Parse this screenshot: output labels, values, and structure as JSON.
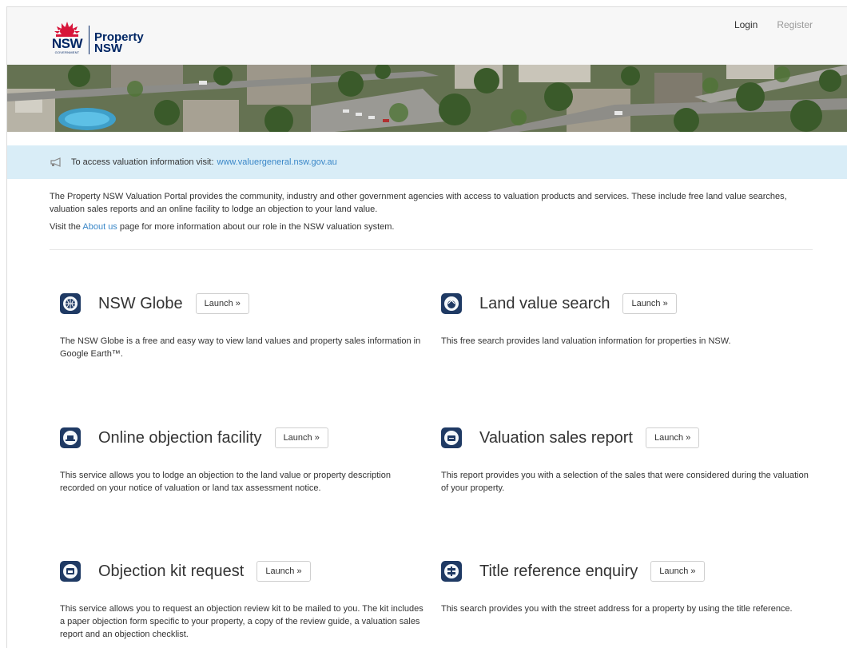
{
  "header": {
    "logo_nsw": "NSW",
    "logo_gov": "GOVERNMENT",
    "logo_property_line1": "Property",
    "logo_property_line2": "NSW",
    "login_label": "Login",
    "register_label": "Register"
  },
  "notice": {
    "text": "To access valuation information visit:",
    "link": "www.valuergeneral.nsw.gov.au"
  },
  "intro": {
    "paragraph": "The Property NSW Valuation Portal provides the community, industry and other government agencies with access to valuation products and services. These include free land value searches, valuation sales reports and an online facility to lodge an objection to your land value.",
    "about_prefix": "Visit the",
    "about_link": "About us",
    "about_suffix": "page for more information about our role in the NSW valuation system."
  },
  "services": [
    {
      "title": "NSW Globe",
      "button": "Launch »",
      "icon": "globe-icon",
      "description": "The NSW Globe is a free and easy way to view land values and property sales information in Google Earth™."
    },
    {
      "title": "Land value search",
      "button": "Launch »",
      "icon": "house-search-icon",
      "description": "This free search provides land valuation information for properties in NSW."
    },
    {
      "title": "Online objection facility",
      "button": "Launch »",
      "icon": "laptop-icon",
      "description": "This service allows you to lodge an objection to the land value or property description recorded on your notice of valuation or land tax assessment notice."
    },
    {
      "title": "Valuation sales report",
      "button": "Launch »",
      "icon": "report-icon",
      "description": "This report provides you with a selection of the sales that were considered during the valuation of your property."
    },
    {
      "title": "Objection kit request",
      "button": "Launch »",
      "icon": "envelope-icon",
      "description": "This service allows you to request an objection review kit to be mailed to you. The kit includes a paper objection form specific to your property, a copy of the review guide, a valuation sales report and an objection checklist."
    },
    {
      "title": "Title reference enquiry",
      "button": "Launch »",
      "icon": "signpost-icon",
      "description": "This search provides you with the street address for a property by using the title reference."
    }
  ],
  "colors": {
    "brand_navy": "#002664",
    "brand_red": "#d7153a",
    "notice_bg": "#d9edf7",
    "link": "#3a87c8",
    "icon_bg": "#1f3a64"
  }
}
